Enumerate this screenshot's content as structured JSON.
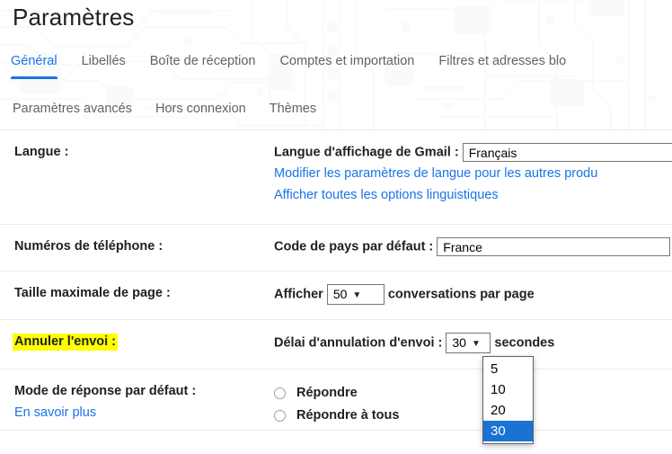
{
  "header": {
    "title": "Paramètres",
    "tabs_primary": [
      {
        "label": "Général",
        "active": true
      },
      {
        "label": "Libellés",
        "active": false
      },
      {
        "label": "Boîte de réception",
        "active": false
      },
      {
        "label": "Comptes et importation",
        "active": false
      },
      {
        "label": "Filtres et adresses blo",
        "active": false
      }
    ],
    "tabs_secondary": [
      {
        "label": "Paramètres avancés"
      },
      {
        "label": "Hors connexion"
      },
      {
        "label": "Thèmes"
      }
    ]
  },
  "rows": {
    "language": {
      "label": "Langue :",
      "field_label": "Langue d'affichage de Gmail :",
      "select_value": "Français",
      "link_1": "Modifier les paramètres de langue pour les autres produ",
      "link_2": "Afficher toutes les options linguistiques"
    },
    "phone": {
      "label": "Numéros de téléphone :",
      "field_label": "Code de pays par défaut :",
      "select_value": "France"
    },
    "page_size": {
      "label": "Taille maximale de page :",
      "prefix": "Afficher",
      "select_value": "50",
      "suffix": "conversations par page"
    },
    "undo_send": {
      "label": "Annuler l'envoi :",
      "highlighted": true,
      "field_label": "Délai d'annulation d'envoi :",
      "select_value": "30",
      "suffix": "secondes",
      "options": [
        "5",
        "10",
        "20",
        "30"
      ],
      "selected_option": "30"
    },
    "default_reply": {
      "label": "Mode de réponse par défaut :",
      "learn_more": "En savoir plus",
      "radio_1": "Répondre",
      "radio_2": "Répondre à tous"
    }
  },
  "colors": {
    "accent": "#1a73e8",
    "highlight": "#ffff00",
    "option_selected_bg": "#1a73d2",
    "text": "#202124",
    "muted_text": "#5f6368",
    "divider": "#e8eaed"
  },
  "icons": {
    "dropdown_caret": "chevron-down-icon"
  }
}
